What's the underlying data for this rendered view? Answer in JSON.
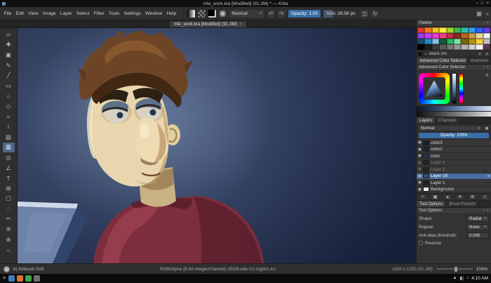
{
  "accent": {
    "selection_blue": "#4a6da0",
    "slider_blue": "#3a6ea5"
  },
  "titlebar": {
    "title": "mte_work.kra [Modified] (91.3M) * — Krita"
  },
  "icons": {
    "minimize": "−",
    "maximize": "□",
    "close": "×",
    "undo": "↶",
    "redo": "↷",
    "dropdown": "▾",
    "overflow": "»",
    "workspace": "▦",
    "eye": "◉",
    "alpha": "α",
    "gear": "⚙",
    "menu": "≡",
    "float": "▫",
    "plus": "+",
    "lock": "▣"
  },
  "menubar": {
    "items": [
      "File",
      "Edit",
      "View",
      "Image",
      "Layer",
      "Select",
      "Filter",
      "Tools",
      "Settings",
      "Window",
      "Help"
    ]
  },
  "toolbar": {
    "blend_mode": "Normal",
    "opacity": "Opacity: 1.00",
    "size": "Size: 28.56 px"
  },
  "tabbar": {
    "label": "mte_work.kra [Modified] (91.3M)"
  },
  "toolbox": {
    "tools": [
      {
        "name": "transform-tool",
        "glyph": "▱",
        "active": false
      },
      {
        "name": "move-tool",
        "glyph": "✚",
        "active": false
      },
      {
        "name": "crop-tool",
        "glyph": "▣",
        "active": false
      },
      {
        "name": "freehand-brush-tool",
        "glyph": "✎",
        "active": false
      },
      {
        "name": "line-tool",
        "glyph": "╱",
        "active": false
      },
      {
        "name": "rectangle-tool",
        "glyph": "▭",
        "active": false
      },
      {
        "name": "ellipse-tool",
        "glyph": "○",
        "active": false
      },
      {
        "name": "polygon-tool",
        "glyph": "◇",
        "active": false
      },
      {
        "name": "polyline-tool",
        "glyph": "≈",
        "active": false
      },
      {
        "name": "bezier-tool",
        "glyph": "≀",
        "active": false
      },
      {
        "name": "fill-tool",
        "glyph": "▨",
        "active": false
      },
      {
        "name": "gradient-tool",
        "glyph": "▥",
        "active": true
      },
      {
        "name": "color-picker-tool",
        "glyph": "◎",
        "active": false
      },
      {
        "name": "measure-tool",
        "glyph": "∠",
        "active": false
      },
      {
        "name": "text-tool",
        "glyph": "T",
        "active": false
      },
      {
        "name": "assistants-tool",
        "glyph": "⊞",
        "active": false
      },
      {
        "name": "select-rectangle-tool",
        "glyph": "▢",
        "active": false
      },
      {
        "name": "select-ellipse-tool",
        "glyph": "◌",
        "active": false
      },
      {
        "name": "select-freehand-tool",
        "glyph": "✂",
        "active": false
      },
      {
        "name": "select-similar-tool",
        "glyph": "⊛",
        "active": false
      },
      {
        "name": "zoom-tool",
        "glyph": "⊕",
        "active": false
      },
      {
        "name": "pan-tool",
        "glyph": "⇔",
        "active": false
      }
    ]
  },
  "palette": {
    "title": "Palette",
    "selected_name": "Black 5%",
    "colors": [
      "#e8392e",
      "#f07e26",
      "#f5c326",
      "#f7ef3a",
      "#a8d62e",
      "#44b549",
      "#2cbfae",
      "#2f9ff0",
      "#2f62f0",
      "#6a3cf0",
      "#9a3cf0",
      "#c93cf0",
      "#f03cd4",
      "#f03c86",
      "#c22f4a",
      "#8a2a20",
      "#b5651d",
      "#d19a45",
      "#e8d5a0",
      "#f5f5f5",
      "#1b4f72",
      "#2e86c1",
      "#85c1e9",
      "#145a32",
      "#28b463",
      "#82e0aa",
      "#7d6608",
      "#b7950b",
      "#f4d03f",
      "#c0c0c0",
      "#000000",
      "#1f1f1f",
      "#3d3d3d",
      "#5b5b5b",
      "#797979",
      "#979797",
      "#b5b5b5",
      "#d3d3d3",
      "#f1f1f1",
      "#5d3754"
    ]
  },
  "color_selector": {
    "tabs": [
      "Advanced Color Selector",
      "Overview"
    ],
    "title": "Advanced Color Selector"
  },
  "layers": {
    "tabs": [
      "Layers",
      "Channels"
    ],
    "blend_mode": "Normal",
    "opacity": "Opacity: 100%",
    "rows": [
      {
        "name": "color3",
        "thumb": "#16202f",
        "dimmed": false,
        "selected": false
      },
      {
        "name": "color2",
        "thumb": "#1a2638",
        "dimmed": false,
        "selected": false
      },
      {
        "name": "color",
        "thumb": "#243550",
        "dimmed": false,
        "selected": false
      },
      {
        "name": "Layer 4",
        "thumb": "#232323",
        "dimmed": true,
        "selected": false
      },
      {
        "name": "Layer 5",
        "thumb": "#232323",
        "dimmed": true,
        "selected": false
      },
      {
        "name": "Layer 16",
        "thumb": "#3c4c66",
        "dimmed": false,
        "selected": true
      },
      {
        "name": "Layer 1",
        "thumb": "#232323",
        "dimmed": false,
        "selected": false
      },
      {
        "name": "Background",
        "thumb": "#e9e9e9",
        "dimmed": false,
        "selected": false
      }
    ],
    "buttons": [
      {
        "name": "add-layer-button",
        "glyph": "+"
      },
      {
        "name": "duplicate-layer-button",
        "glyph": "▣"
      },
      {
        "name": "move-layer-up-button",
        "glyph": "▲"
      },
      {
        "name": "move-layer-down-button",
        "glyph": "▼"
      },
      {
        "name": "layer-properties-button",
        "glyph": "⚙"
      },
      {
        "name": "delete-layer-button",
        "glyph": "×"
      }
    ]
  },
  "tool_options": {
    "tabs": [
      "Tool Options",
      "Brush Presets"
    ],
    "title": "Tool Options",
    "rows": [
      {
        "label": "Shape:",
        "value": "Radial",
        "dropdown": true,
        "name": "shape-select"
      },
      {
        "label": "Repeat:",
        "value": "None",
        "dropdown": true,
        "name": "repeat-select"
      },
      {
        "label": "Anti-alias threshold:",
        "value": "0.000",
        "dropdown": false,
        "name": "antialias-threshold-input"
      }
    ],
    "reverse_label": "Reverse"
  },
  "statusbar": {
    "brush_preset": "b) Airbrush Soft",
    "colorspace": "RGB/Alpha (8-bit integer/channel)  sRGB-elle-V2-srgbtrc.icc",
    "canvas_size": "1920 x 1200 (91.3M)",
    "zoom": "104%"
  },
  "taskbar": {
    "apps": [
      {
        "name": "taskbar-app-1",
        "color": "#3f7fbf"
      },
      {
        "name": "taskbar-app-2",
        "color": "#d8742c"
      },
      {
        "name": "taskbar-app-3",
        "color": "#3fa34d"
      },
      {
        "name": "taskbar-app-4",
        "color": "#6f6f6f"
      }
    ],
    "tray": [
      {
        "name": "tray-up-icon",
        "glyph": "▲"
      },
      {
        "name": "tray-network-icon",
        "glyph": "◧"
      },
      {
        "name": "tray-volume-icon",
        "glyph": "♪"
      }
    ],
    "clock": "4:10 AM"
  },
  "canvas": {
    "colors": {
      "background_dark": "#1b2540",
      "background_light": "#4e6080",
      "skin": "#e9d6ae",
      "skin_shadow": "#bfa172",
      "hair": "#6d4526",
      "hair_dark": "#422812",
      "sweater": "#7c2e3d",
      "sweater_dark": "#5a1e2b",
      "sweater_light": "#a34456",
      "eyelid": "#5f7189",
      "object_blue": "#6e82a8",
      "object_blue_dark": "#2f4468"
    }
  }
}
